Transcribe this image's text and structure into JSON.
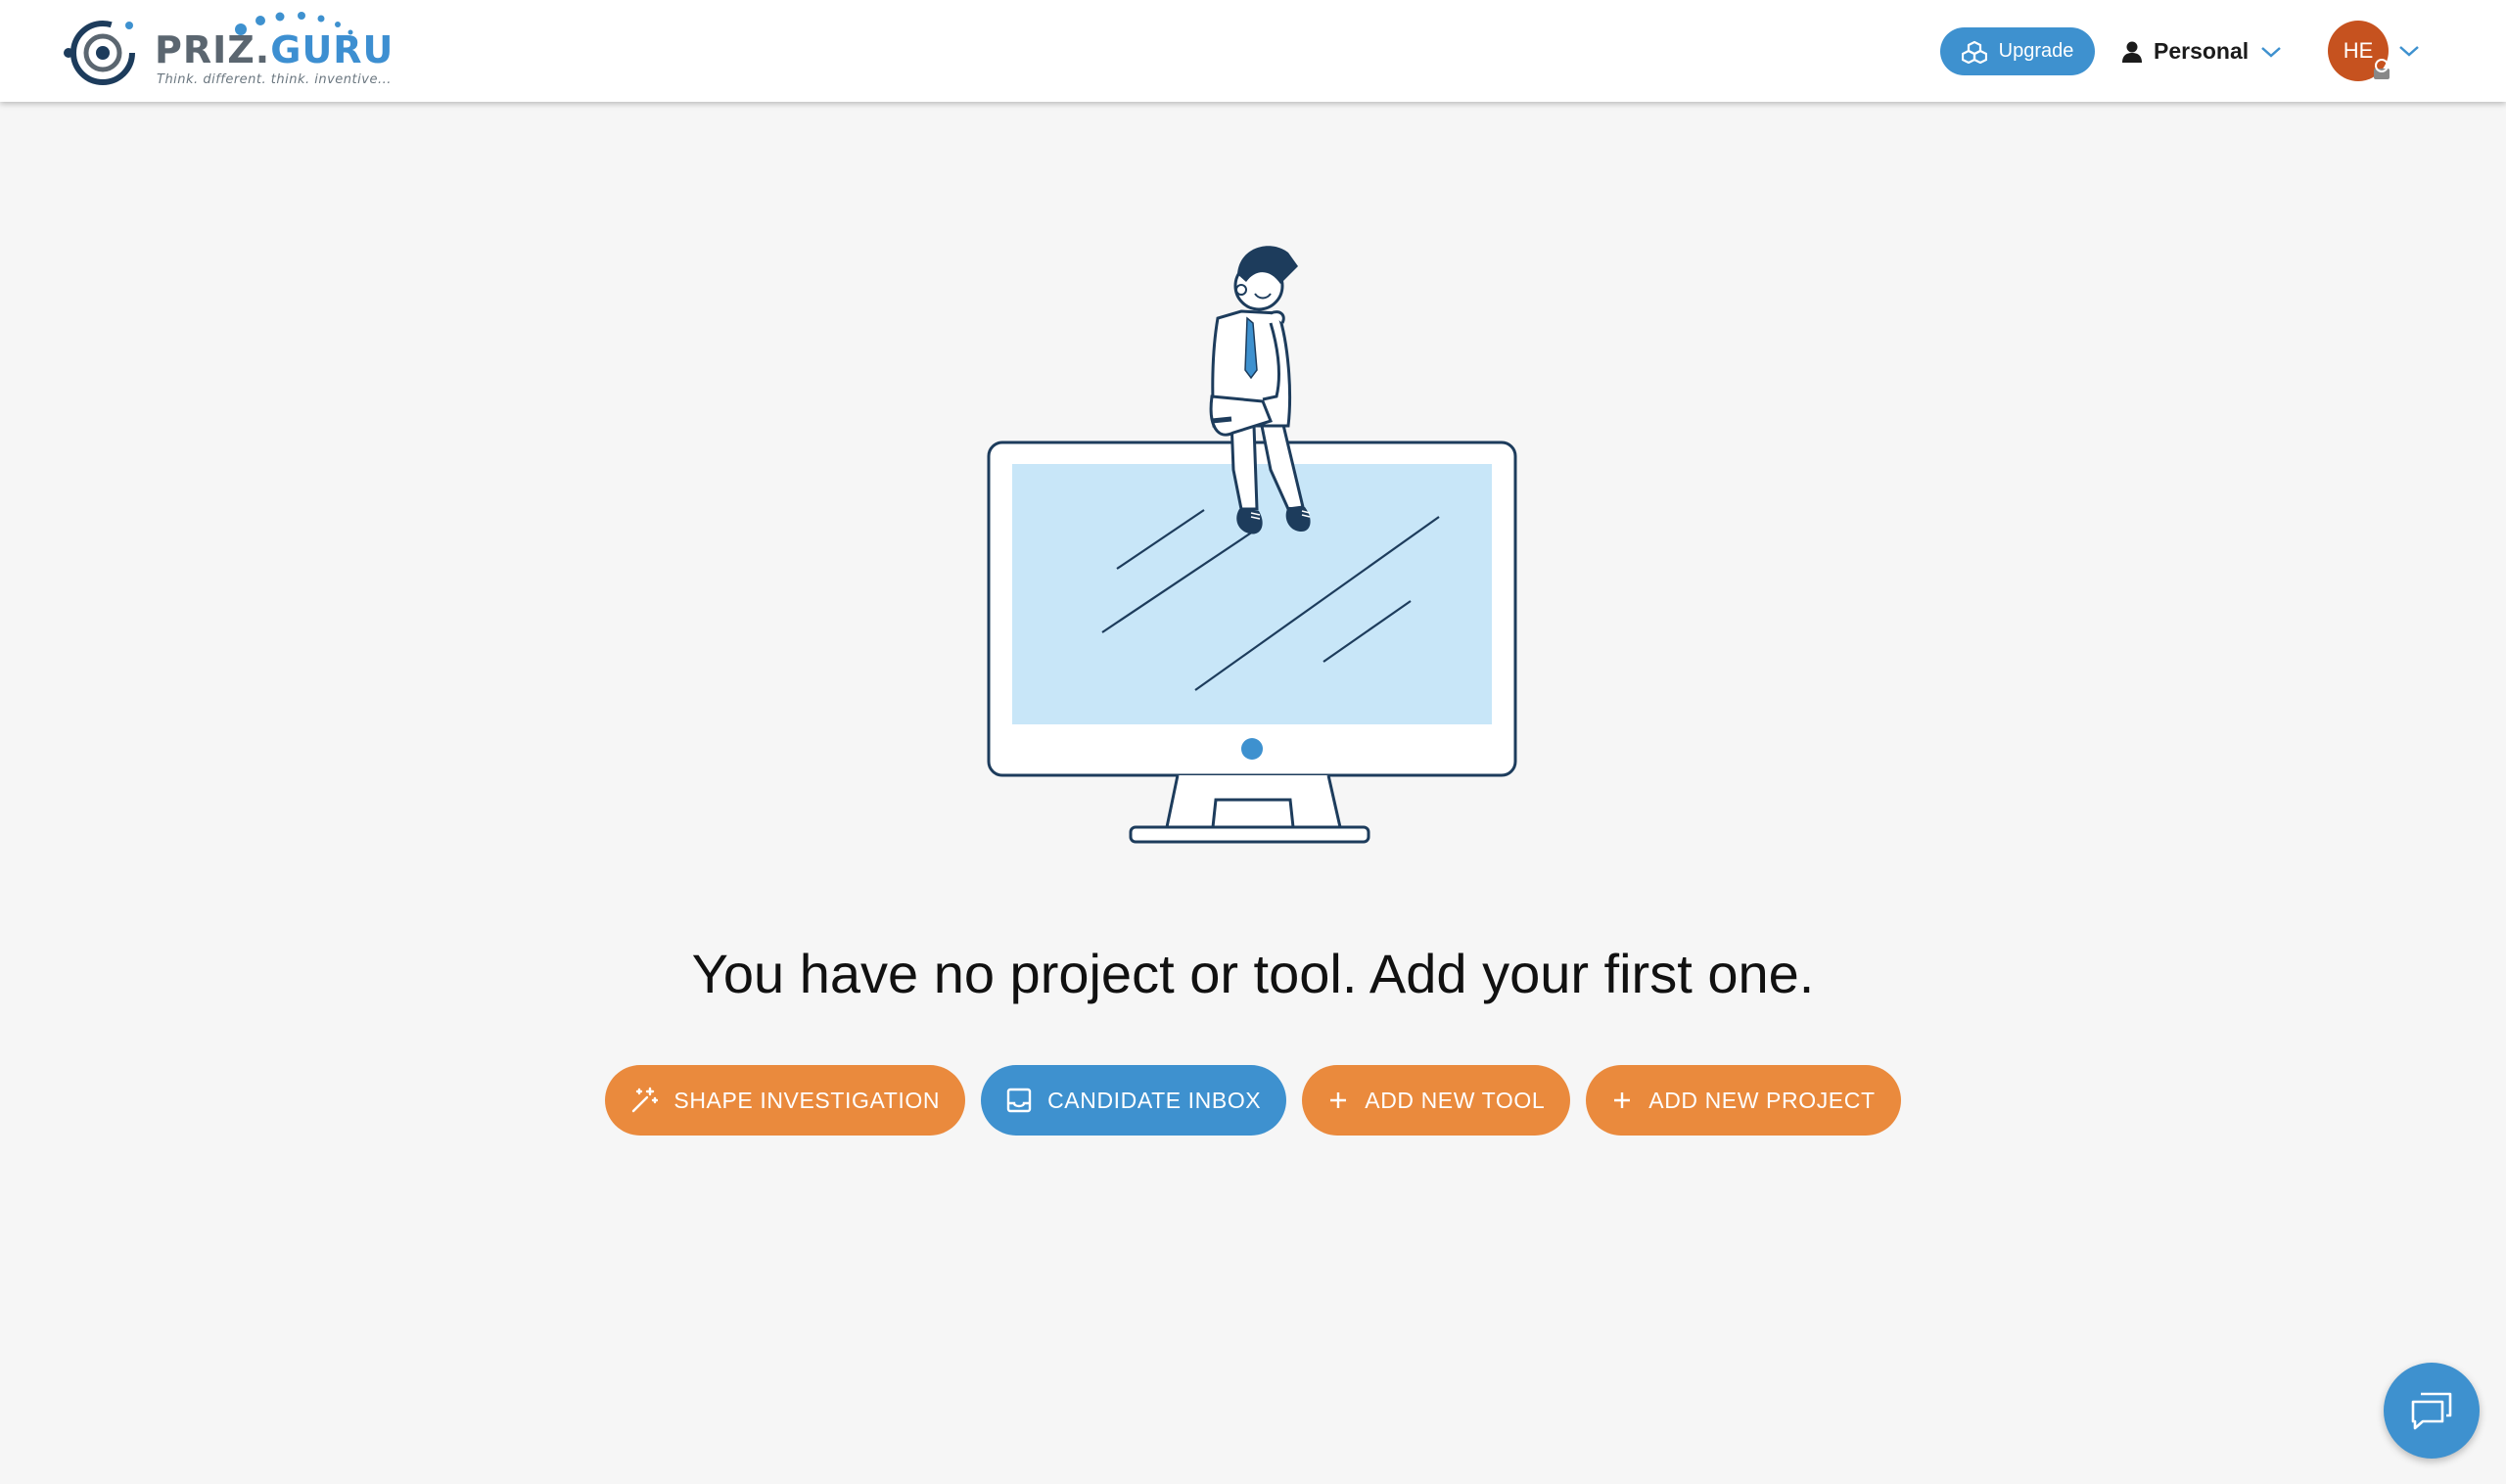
{
  "header": {
    "logo": {
      "wordmark_priz": "PRIZ.",
      "wordmark_guru": "GURU",
      "tagline": "Think. different. think. inventive..."
    },
    "upgrade_label": "Upgrade",
    "workspace_label": "Personal",
    "avatar_initials": "HE"
  },
  "main": {
    "headline": "You have no project or tool. Add your first one.",
    "actions": [
      {
        "label": "SHAPE INVESTIGATION",
        "icon": "magic-wand-icon",
        "color": "#ea8a3d"
      },
      {
        "label": "CANDIDATE INBOX",
        "icon": "inbox-icon",
        "color": "#3e91cf"
      },
      {
        "label": "ADD NEW TOOL",
        "icon": "plus-icon",
        "color": "#ea8a3d"
      },
      {
        "label": "ADD NEW PROJECT",
        "icon": "plus-icon",
        "color": "#ea8a3d"
      }
    ]
  },
  "chat": {
    "icon": "chat-icon"
  },
  "colors": {
    "brand_blue": "#3e91cf",
    "brand_orange": "#ea8a3d",
    "avatar": "#c6521f",
    "illustration_navy": "#1d3c5c",
    "screen_fill": "#c8e6f8"
  }
}
